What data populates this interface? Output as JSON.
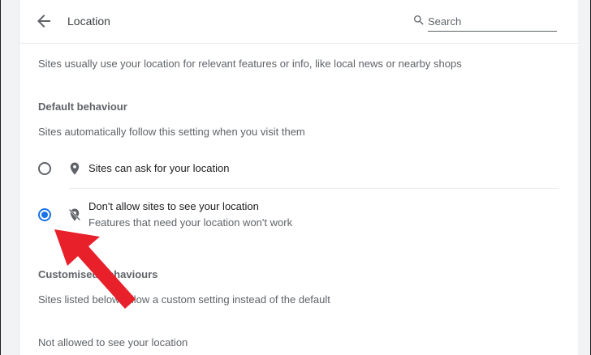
{
  "header": {
    "title": "Location",
    "back_icon": "arrow-back-icon",
    "search": {
      "placeholder": "Search",
      "value": "",
      "icon": "search-icon"
    }
  },
  "intro": "Sites usually use your location for relevant features or info, like local news or nearby shops",
  "default_behaviour": {
    "heading": "Default behaviour",
    "description": "Sites automatically follow this setting when you visit them",
    "options": [
      {
        "label": "Sites can ask for your location",
        "sublabel": "",
        "icon": "location-pin-icon",
        "selected": false
      },
      {
        "label": "Don't allow sites to see your location",
        "sublabel": "Features that need your location won't work",
        "icon": "location-off-icon",
        "selected": true
      }
    ]
  },
  "customised_behaviours": {
    "heading": "Customised behaviours",
    "description": "Sites listed below follow a custom setting instead of the default",
    "not_allowed_heading": "Not allowed to see your location"
  },
  "colors": {
    "accent": "#1a73e8",
    "annotation_arrow": "#e8202a"
  }
}
